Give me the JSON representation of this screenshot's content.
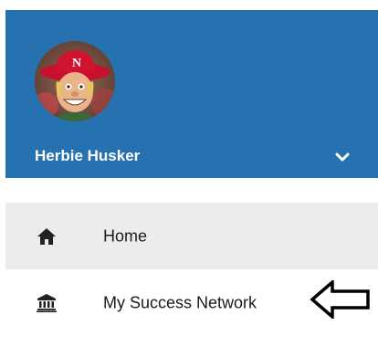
{
  "user": {
    "name": "Herbie Husker",
    "avatar_icon": "herbie-husker-mascot-avatar"
  },
  "header": {
    "background": "#2672b0",
    "dropdown_icon": "chevron-down-icon"
  },
  "nav": {
    "items": [
      {
        "label": "Home",
        "icon": "home-icon",
        "active": true
      },
      {
        "label": "My Success Network",
        "icon": "bank-building-icon",
        "active": false
      }
    ]
  },
  "annotation": {
    "icon": "left-arrow-outline-icon"
  }
}
